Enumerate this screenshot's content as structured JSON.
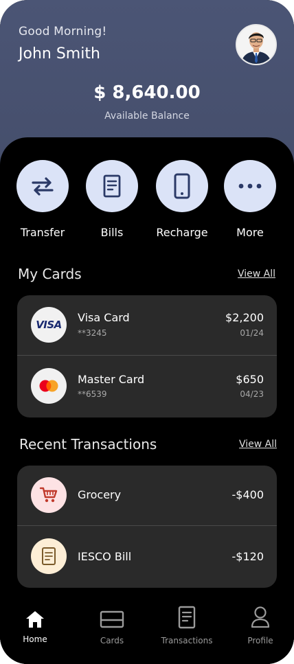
{
  "header": {
    "greeting": "Good Morning!",
    "user_name": "John Smith",
    "balance": "$ 8,640.00",
    "balance_label": "Available Balance"
  },
  "quick_actions": [
    {
      "label": "Transfer",
      "icon": "transfer-icon"
    },
    {
      "label": "Bills",
      "icon": "bill-icon"
    },
    {
      "label": "Recharge",
      "icon": "phone-icon"
    },
    {
      "label": "More",
      "icon": "more-icon"
    }
  ],
  "cards_section": {
    "title": "My Cards",
    "view_all": "View All",
    "items": [
      {
        "name": "Visa Card",
        "number": "**3245",
        "amount": "$2,200",
        "expiry": "01/24",
        "logo_text": "VISA",
        "icon": "visa-logo-icon"
      },
      {
        "name": "Master Card",
        "number": "**6539",
        "amount": "$650",
        "expiry": "04/23",
        "icon": "mastercard-logo-icon"
      }
    ]
  },
  "transactions_section": {
    "title": "Recent Transactions",
    "view_all": "View All",
    "items": [
      {
        "name": "Grocery",
        "amount": "-$400",
        "icon": "shopping-cart-icon",
        "icon_bg": "#fde2e4",
        "icon_color": "#c0392b"
      },
      {
        "name": "IESCO Bill",
        "amount": "-$120",
        "icon": "receipt-icon",
        "icon_bg": "#fdeed6",
        "icon_color": "#7a5a2a"
      }
    ]
  },
  "tabbar": {
    "items": [
      {
        "label": "Home",
        "icon": "home-icon",
        "active": true
      },
      {
        "label": "Cards",
        "icon": "card-icon",
        "active": false
      },
      {
        "label": "Transactions",
        "icon": "document-icon",
        "active": false
      },
      {
        "label": "Profile",
        "icon": "profile-icon",
        "active": false
      }
    ]
  },
  "colors": {
    "header_bg": "#4b5575",
    "action_circle": "#dbe3f7",
    "action_icon": "#2b3a67",
    "panel_bg": "#2a2a2a"
  }
}
